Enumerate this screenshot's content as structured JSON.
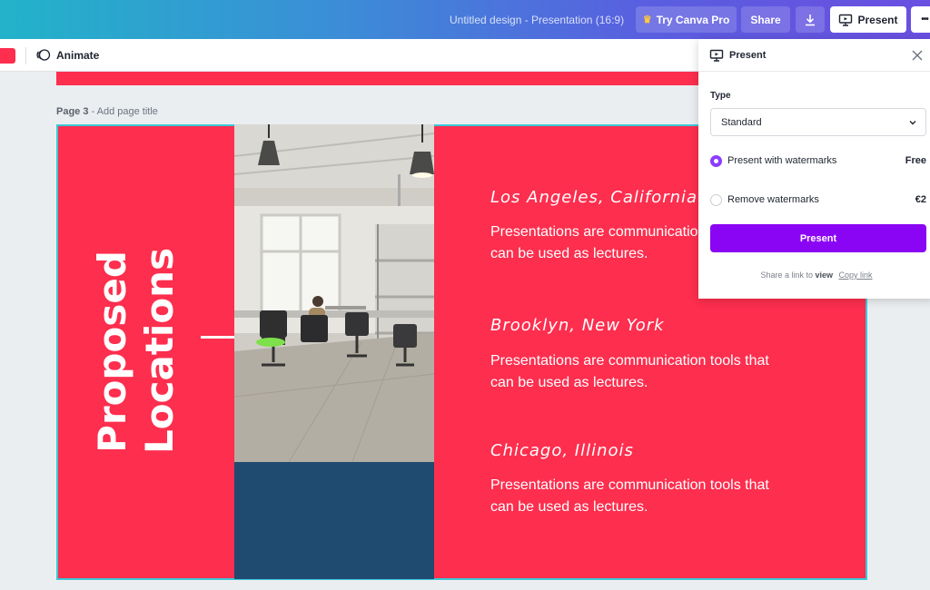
{
  "header": {
    "doc_title": "Untitled design - Presentation (16:9)",
    "try_pro_label": "Try Canva Pro",
    "share_label": "Share",
    "present_label": "Present",
    "more_label": "•••"
  },
  "toolbar": {
    "animate_label": "Animate",
    "swatch_color": "#fd2e4e"
  },
  "canvas": {
    "page_label_prefix": "Page 3",
    "page_label_suffix": " - Add page title"
  },
  "slide": {
    "vertical_title_line1": "Proposed",
    "vertical_title_line2": "Locations",
    "locations": [
      {
        "title": "Los Angeles, California",
        "body": "Presentations are communication tools that can be used as lectures."
      },
      {
        "title": "Brooklyn, New York",
        "body": "Presentations are communication tools that can be used as lectures."
      },
      {
        "title": "Chicago, Illinois",
        "body": "Presentations are communication tools that can be used as lectures."
      }
    ],
    "colors": {
      "background": "#fd2e4e",
      "navy": "#1f4b70",
      "accent": "#3cc8d6"
    }
  },
  "present_panel": {
    "title": "Present",
    "type_label": "Type",
    "type_value": "Standard",
    "options": [
      {
        "label": "Present with watermarks",
        "price": "Free",
        "selected": true
      },
      {
        "label": "Remove watermarks",
        "price": "€2",
        "selected": false
      }
    ],
    "present_button": "Present",
    "share_text": "Share a link to",
    "share_view": "view",
    "copy_link": "Copy link",
    "accent_color": "#8b05f5"
  }
}
